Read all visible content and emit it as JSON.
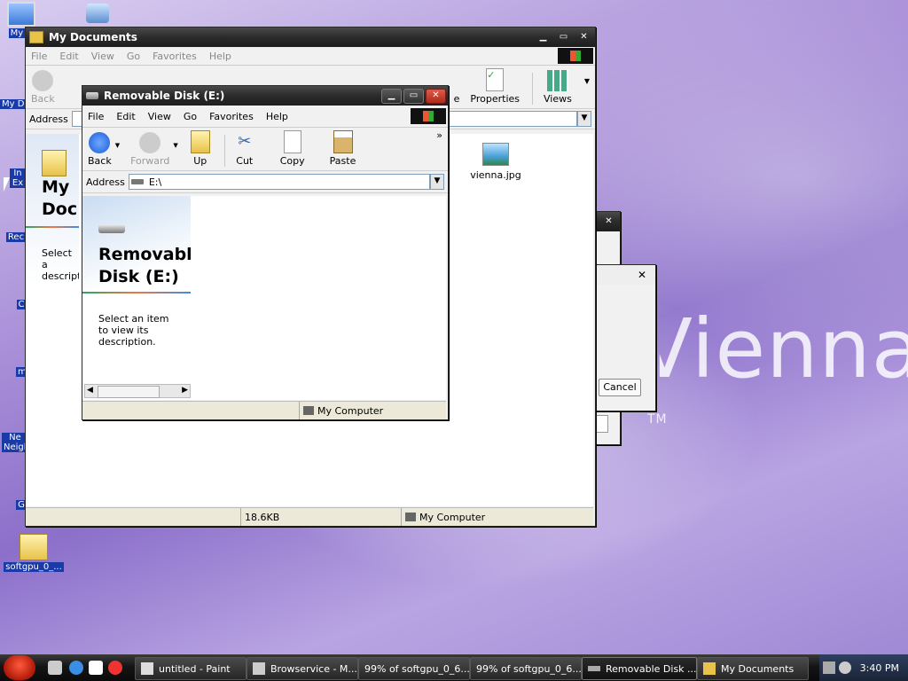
{
  "desktop": {
    "icons": [
      {
        "label": "My C"
      },
      {
        "label": "My Do"
      },
      {
        "label": "In Ex"
      },
      {
        "label": "Rec"
      },
      {
        "label": "C"
      },
      {
        "label": "m"
      },
      {
        "label": "Ne Neigh"
      },
      {
        "label": "G"
      },
      {
        "label": "softgpu_0_..."
      }
    ],
    "wallpaper_text": "Vienna",
    "wallpaper_tm": "TM"
  },
  "my_documents": {
    "title": "My Documents",
    "menu": [
      "File",
      "Edit",
      "View",
      "Go",
      "Favorites",
      "Help"
    ],
    "toolbar": {
      "back": "Back",
      "properties": "Properties",
      "views": "Views",
      "partial": "e"
    },
    "address_label": "Address",
    "side_title": "My Doc",
    "side_desc": "Select a descript",
    "file": {
      "name": "vienna.jpg"
    },
    "status": {
      "size": "18.6KB",
      "zone": "My Computer"
    }
  },
  "removable_disk": {
    "title": "Removable Disk (E:)",
    "menu": [
      "File",
      "Edit",
      "View",
      "Go",
      "Favorites",
      "Help"
    ],
    "toolbar": {
      "back": "Back",
      "forward": "Forward",
      "up": "Up",
      "cut": "Cut",
      "copy": "Copy",
      "paste": "Paste",
      "more": "»"
    },
    "address_label": "Address",
    "address_value": "E:\\",
    "side_title": "Removable Disk (E:)",
    "side_desc": "Select an item to view its description.",
    "status": {
      "zone": "My Computer"
    }
  },
  "dialog": {
    "cancel": "Cancel"
  },
  "taskbar": {
    "buttons": [
      {
        "label": "untitled - Paint"
      },
      {
        "label": "Browservice - M..."
      },
      {
        "label": "99% of softgpu_0_6..."
      },
      {
        "label": "99% of softgpu_0_6..."
      },
      {
        "label": "Removable Disk ..."
      },
      {
        "label": "My Documents"
      }
    ],
    "clock": "3:40 PM"
  },
  "colors": {
    "accent": "#1a3aa8",
    "titlebar": "#2b2b2b",
    "close": "#c0392b"
  }
}
